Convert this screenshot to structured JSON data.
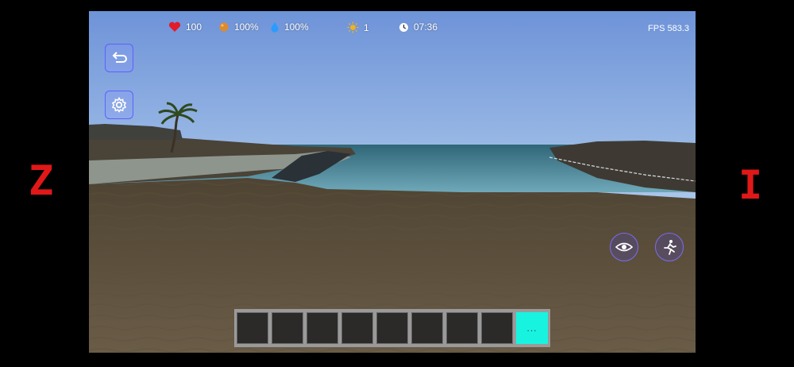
{
  "side_glyphs": {
    "left": "Z",
    "right": "I"
  },
  "hud": {
    "health": "100",
    "food": "100%",
    "water": "100%",
    "day": "1",
    "time": "07:36",
    "fps": "FPS 583.3"
  },
  "icons": {
    "health": "heart-icon",
    "food": "food-icon",
    "water": "water-drop-icon",
    "day": "sun-icon",
    "time": "clock-icon",
    "back": "undo-arrow-icon",
    "settings": "gear-icon",
    "view": "eye-icon",
    "action": "running-person-icon"
  },
  "colors": {
    "health": "#e21b2a",
    "food": "#e08a2a",
    "water": "#2a9bff",
    "day": "#f2b31b",
    "hotbar_more": "#18f3e0",
    "side_glyph": "#e01818",
    "button_border": "#7a6cf0"
  },
  "hotbar": {
    "slots": [
      "",
      "",
      "",
      "",
      "",
      "",
      "",
      ""
    ],
    "more_label": "..."
  }
}
